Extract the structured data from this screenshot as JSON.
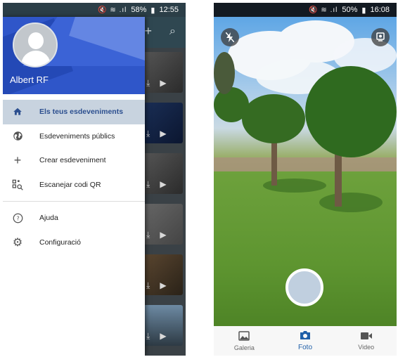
{
  "left_screen": {
    "status": {
      "battery": "58%",
      "time": "12:55"
    },
    "drawer": {
      "user_name": "Albert RF",
      "menu": [
        {
          "label": "Els teus esdeveniments",
          "icon": "home-icon",
          "active": true
        },
        {
          "label": "Esdeveniments públics",
          "icon": "globe-icon",
          "active": false
        },
        {
          "label": "Crear esdeveniment",
          "icon": "plus-icon",
          "active": false
        },
        {
          "label": "Escanejar codi QR",
          "icon": "qr-scan-icon",
          "active": false
        },
        {
          "label": "Ajuda",
          "icon": "help-icon",
          "active": false
        },
        {
          "label": "Configuració",
          "icon": "settings-icon",
          "active": false
        }
      ]
    }
  },
  "right_screen": {
    "status": {
      "battery": "50%",
      "time": "16:08"
    },
    "bottom_nav": [
      {
        "label": "Galeria",
        "icon": "gallery-icon",
        "active": false
      },
      {
        "label": "Foto",
        "icon": "camera-icon",
        "active": true
      },
      {
        "label": "Video",
        "icon": "video-icon",
        "active": false
      }
    ]
  },
  "colors": {
    "drawer_header": "#2f56c9",
    "active_item_bg": "#c8d3df",
    "active_tab": "#1f5fa8"
  }
}
